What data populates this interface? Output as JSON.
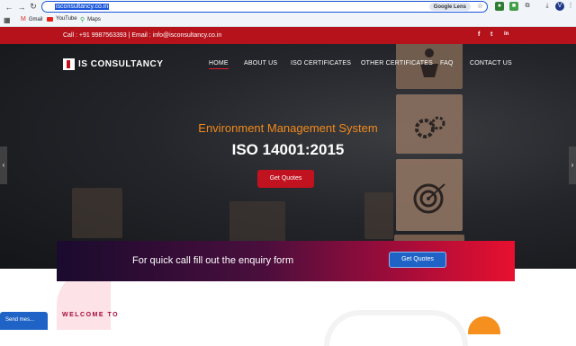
{
  "browser": {
    "url": "isconsultancy.co.in",
    "lens_label": "Google Lens",
    "bookmarks": [
      {
        "label": "Gmail",
        "icon": "gmail-icon"
      },
      {
        "label": "YouTube",
        "icon": "youtube-icon"
      },
      {
        "label": "Maps",
        "icon": "maps-icon"
      }
    ]
  },
  "topbar": {
    "contact": "Call : +91 9987563393 | Email : info@isconsultancy.co.in",
    "social": [
      "f",
      "t",
      "in"
    ]
  },
  "header": {
    "logo_text": "IS CONSULTANCY",
    "menu": [
      "HOME",
      "ABOUT US",
      "ISO CERTIFICATES",
      "OTHER CERTIFICATES",
      "FAQ",
      "CONTACT US"
    ]
  },
  "hero": {
    "subtitle": "Environment Management System",
    "title": "ISO 14001:2015",
    "cta": "Get Quotes"
  },
  "enquiry": {
    "text": "For quick call fill out the enquiry form",
    "button": "Get Quotes"
  },
  "welcome": "WELCOME TO",
  "chat": "Send mes...",
  "colors": {
    "brand_red": "#b5121b",
    "accent_orange": "#f08a1c",
    "cta_blue": "#1e63c5"
  }
}
